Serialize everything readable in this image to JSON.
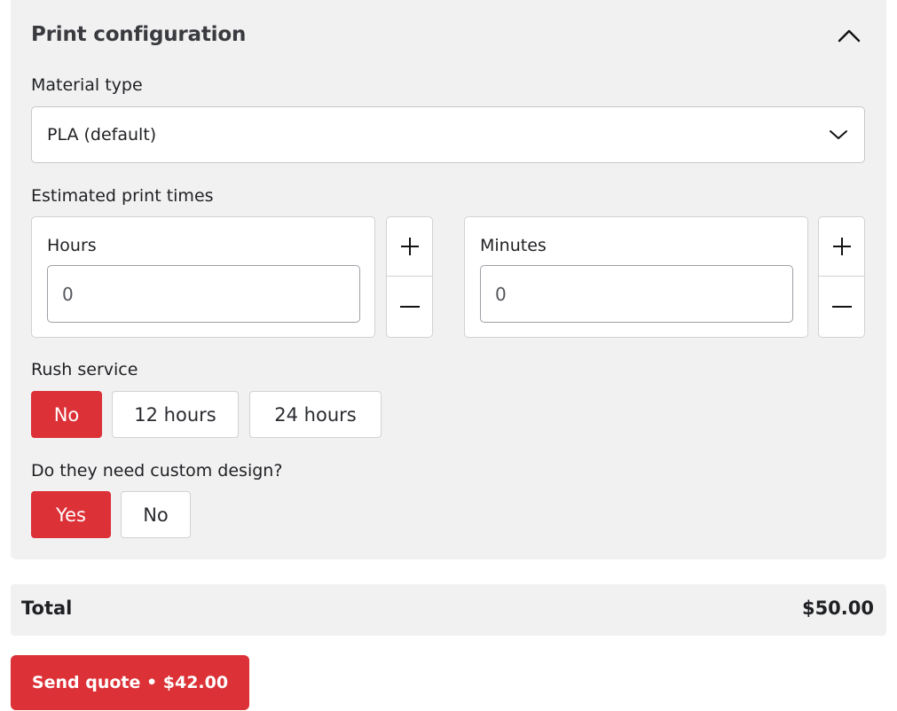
{
  "print_config": {
    "title": "Print configuration",
    "collapse_icon": "chevron-up-icon",
    "material": {
      "label": "Material type",
      "selected": "PLA (default)",
      "dropdown_icon": "chevron-down-icon"
    },
    "print_times": {
      "label": "Estimated print times",
      "hours": {
        "label": "Hours",
        "value": "0"
      },
      "minutes": {
        "label": "Minutes",
        "value": "0"
      },
      "increment_icon": "plus-icon",
      "decrement_icon": "minus-icon"
    },
    "rush": {
      "label": "Rush service",
      "options": [
        "No",
        "12 hours",
        "24 hours"
      ],
      "selected": "No"
    },
    "custom_design": {
      "label": "Do they need custom design?",
      "options": [
        "Yes",
        "No"
      ],
      "selected": "Yes"
    }
  },
  "total": {
    "label": "Total",
    "value": "$50.00"
  },
  "send_button": {
    "label": "Send quote • $42.00"
  },
  "colors": {
    "accent": "#dc3137",
    "panel_bg": "#f1f1f2",
    "border": "#d2d2d6"
  }
}
